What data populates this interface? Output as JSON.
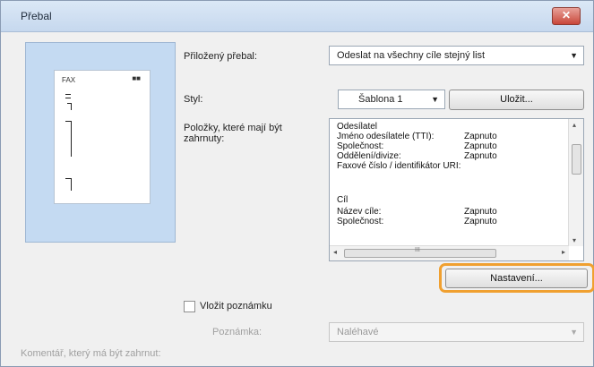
{
  "window": {
    "title": "Přebal",
    "close_label": "✕"
  },
  "preview": {
    "paper_left": "FAX",
    "paper_right": "■■"
  },
  "fields": {
    "attached_label": "Přiložený přebal:",
    "attached_value": "Odeslat na všechny cíle stejný list",
    "style_label": "Styl:",
    "style_value": "Šablona 1",
    "save_button": "Uložit...",
    "items_label": "Položky, které mají být zahrnuty:"
  },
  "list_rows": [
    {
      "name": "Odesílatel",
      "value": ""
    },
    {
      "name": "Jméno odesílatele (TTI):",
      "value": "Zapnuto"
    },
    {
      "name": "Společnost:",
      "value": "Zapnuto"
    },
    {
      "name": "Oddělení/divize:",
      "value": "Zapnuto"
    },
    {
      "name": "Faxové číslo / identifikátor URI:",
      "value": ""
    },
    {
      "name": "",
      "value": ""
    },
    {
      "name": "Cíl",
      "value": ""
    },
    {
      "name": "Název cíle:",
      "value": "Zapnuto"
    },
    {
      "name": "Společnost:",
      "value": "Zapnuto"
    }
  ],
  "scroll": {
    "left": "◂",
    "right": "▸",
    "up": "▴",
    "down": "▾",
    "h_grip": "III"
  },
  "settings_button": "Nastavení...",
  "note": {
    "checkbox_label": "Vložit poznámku",
    "note_label": "Poznámka:",
    "note_value": "Naléhavé"
  },
  "footer_label": "Komentář, který má být zahrnut:",
  "colors": {
    "highlight": "#f0a030",
    "preview_bg": "#c4daf2"
  }
}
